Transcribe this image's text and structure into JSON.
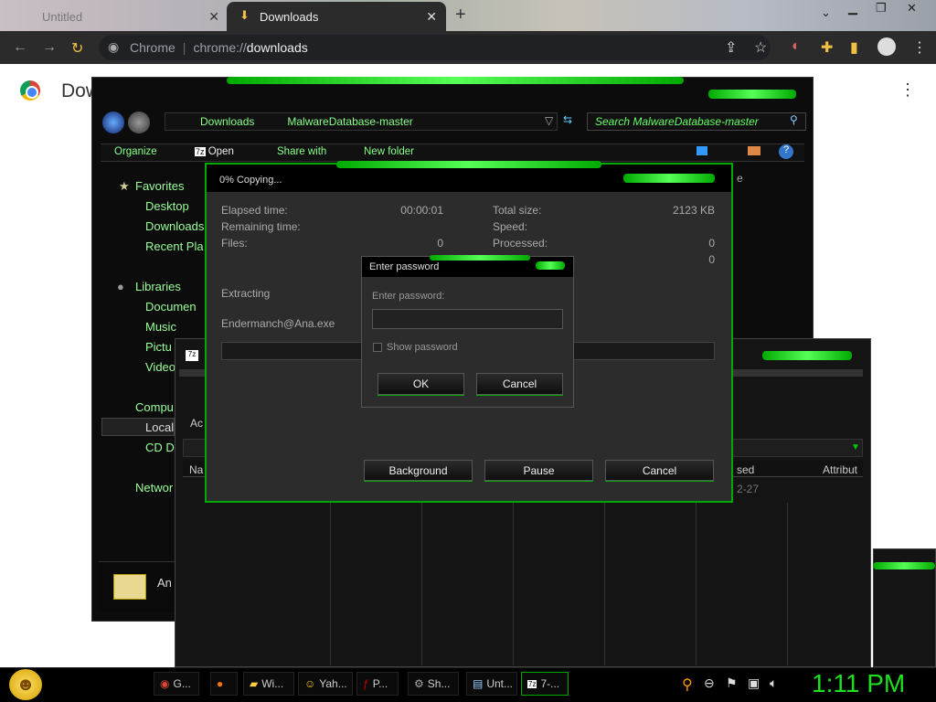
{
  "browser": {
    "tabs": [
      {
        "title": "Untitled"
      },
      {
        "title": "Downloads"
      }
    ],
    "url_prefix": "chrome://",
    "url_path": "downloads",
    "site_label": "Chrome"
  },
  "page": {
    "title": "Dow"
  },
  "explorer": {
    "breadcrumb": [
      "Downloads",
      "MalwareDatabase-master"
    ],
    "search_placeholder": "Search MalwareDatabase-master",
    "commands": [
      "Organize",
      "Open",
      "Share with",
      "New folder"
    ],
    "nav": [
      {
        "label": "Favorites",
        "group": true
      },
      {
        "label": "Desktop"
      },
      {
        "label": "Downloads"
      },
      {
        "label": "Recent Pla"
      },
      {
        "label": "Libraries",
        "group": true
      },
      {
        "label": "Documen"
      },
      {
        "label": "Music"
      },
      {
        "label": "Pictu"
      },
      {
        "label": "Video"
      },
      {
        "label": "Compu",
        "group": true
      },
      {
        "label": "Local"
      },
      {
        "label": "CD D"
      },
      {
        "label": "Networ",
        "group": true
      }
    ],
    "bottom_label": "An"
  },
  "copy_dialog": {
    "title": "0% Copying...",
    "elapsed_label": "Elapsed time:",
    "elapsed_value": "00:00:01",
    "remaining_label": "Remaining time:",
    "files_label": "Files:",
    "files_value": "0",
    "total_label": "Total size:",
    "total_value": "2123 KB",
    "speed_label": "Speed:",
    "processed_label": "Processed:",
    "processed_value": "0",
    "extra_value": "0",
    "status": "Extracting",
    "filename": "Endermanch@Ana.exe",
    "buttons": {
      "background": "Background",
      "pause": "Pause",
      "cancel": "Cancel"
    }
  },
  "password_dialog": {
    "title": "Enter password",
    "prompt": "Enter password:",
    "show_password": "Show password",
    "ok": "OK",
    "cancel": "Cancel"
  },
  "back_window": {
    "partial_left": "Ac",
    "partial_col": "Na",
    "col_used": "sed",
    "col_attr": "Attribut",
    "date_fragment": "2-27",
    "field_fragment": "e"
  },
  "taskbar": {
    "items": [
      {
        "label": "G..."
      },
      {
        "label": ""
      },
      {
        "label": "Wi..."
      },
      {
        "label": "Yah..."
      },
      {
        "label": "P..."
      },
      {
        "label": "Sh..."
      },
      {
        "label": "Unt..."
      },
      {
        "label": "7-..."
      }
    ],
    "clock": "1:11 PM"
  }
}
